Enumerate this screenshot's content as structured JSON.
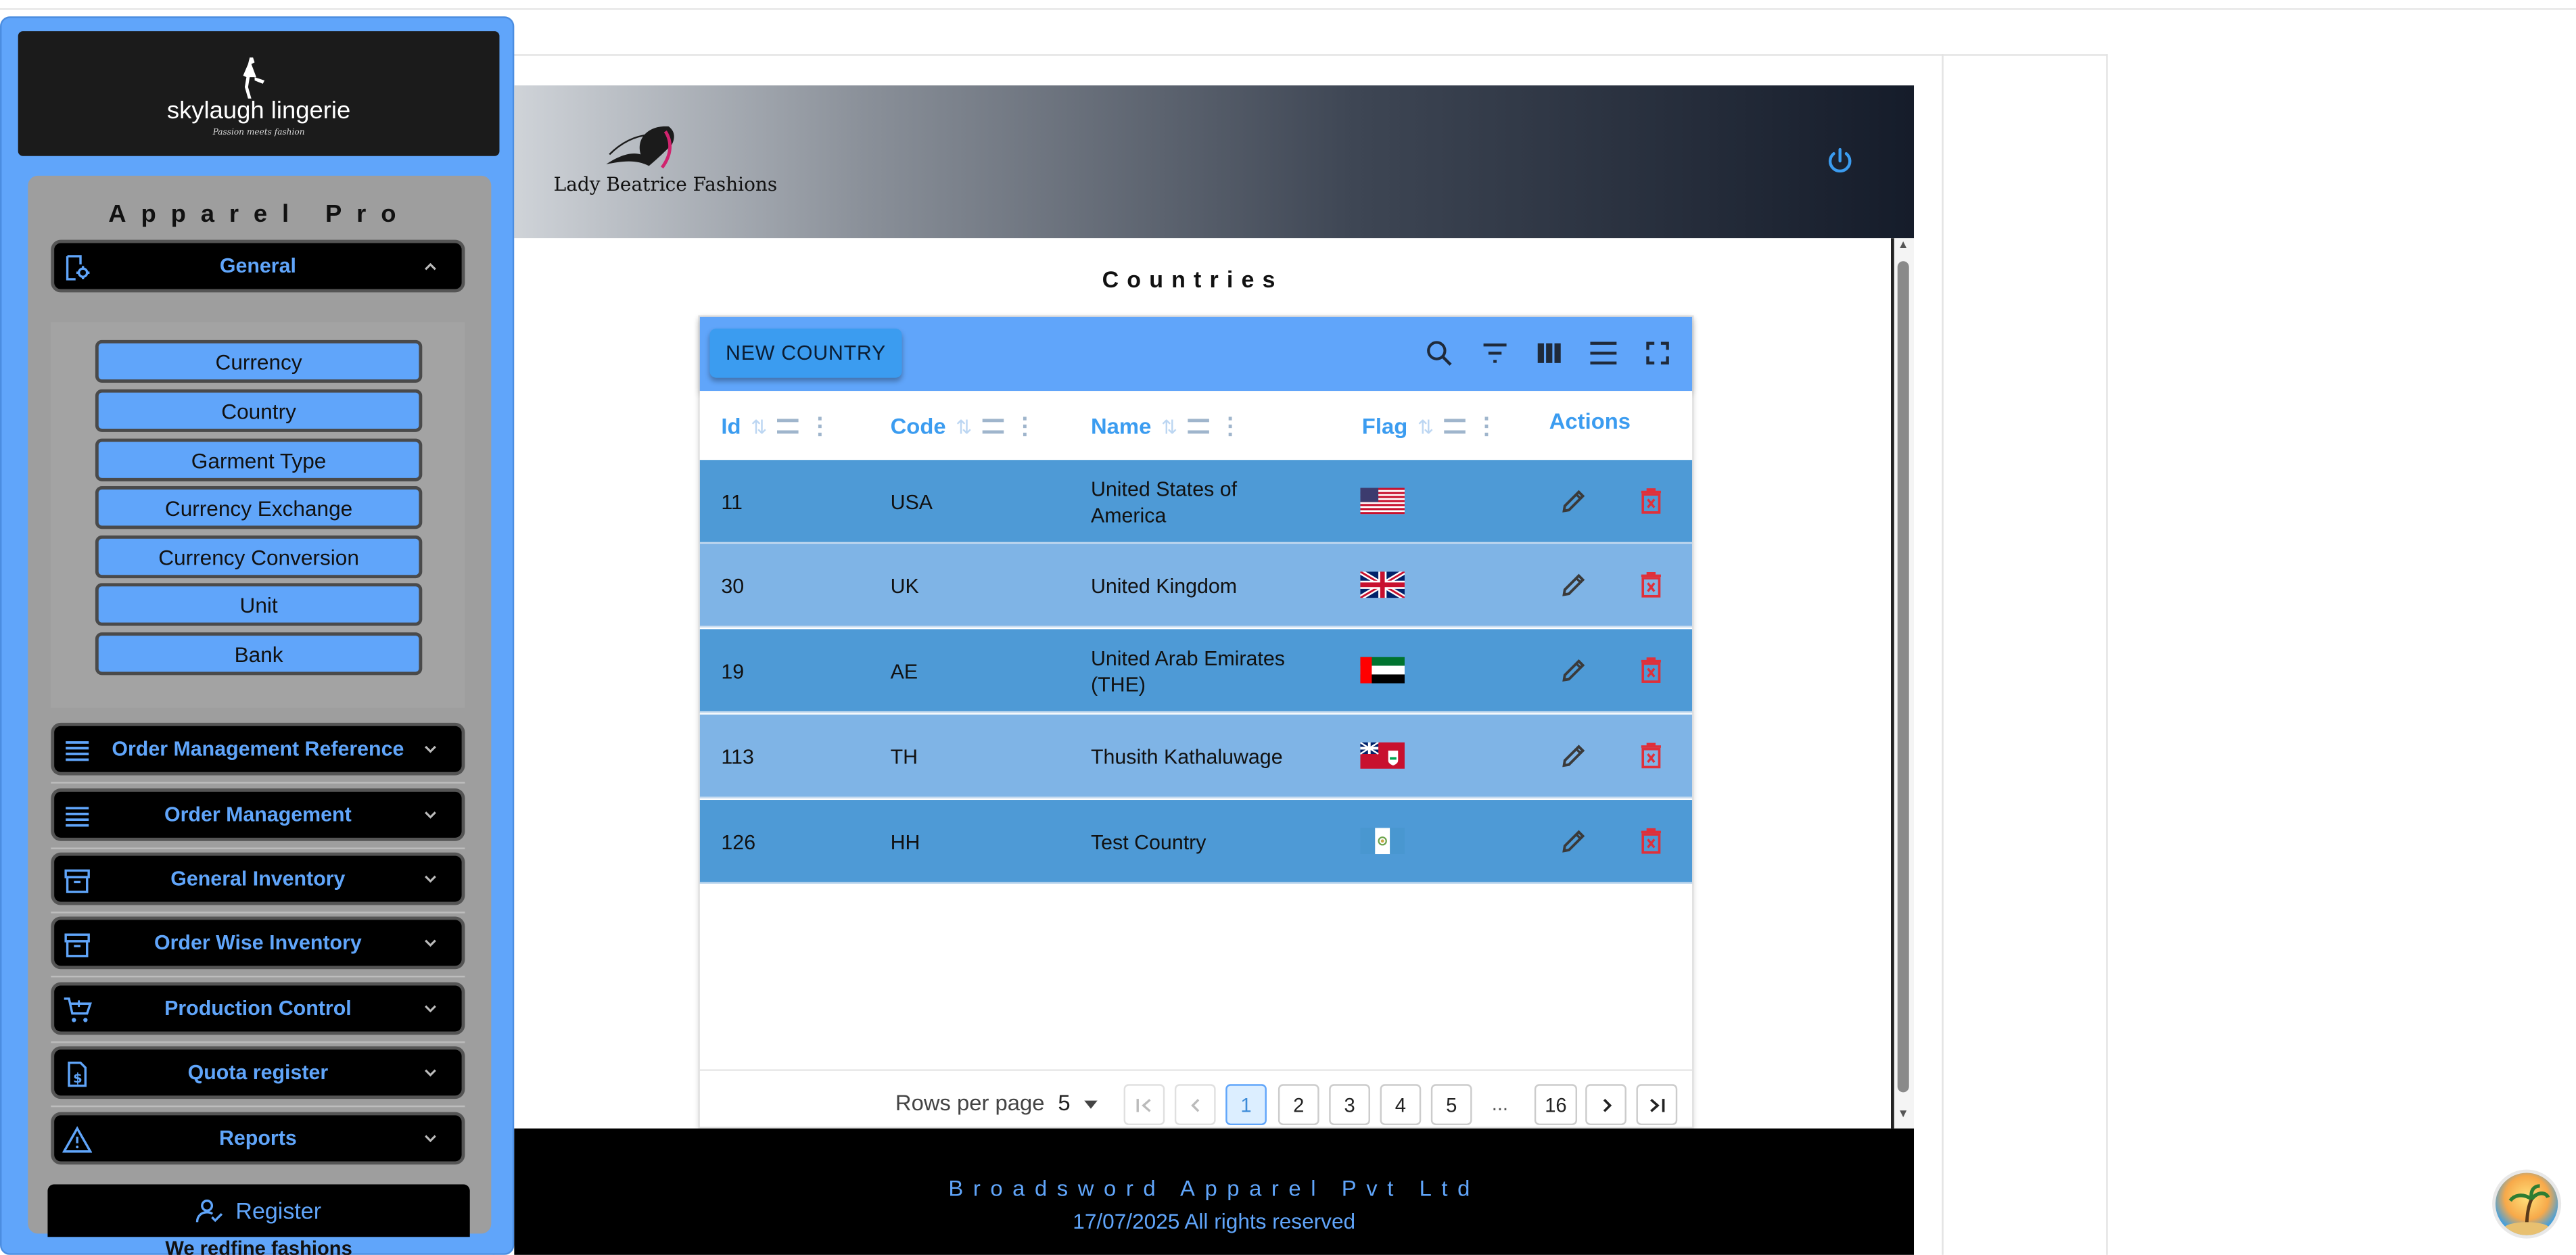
{
  "sidebar": {
    "logo_text": "skylaugh lingerie",
    "logo_tagline": "Passion meets fashion",
    "app_title": "Apparel Pro",
    "general": {
      "label": "General",
      "icon": "settings-document-icon"
    },
    "sub_items": [
      "Currency",
      "Country",
      "Garment Type",
      "Currency Exchange",
      "Currency Conversion",
      "Unit",
      "Bank"
    ],
    "sections": [
      {
        "label": "Order Management Reference",
        "icon": "list-icon"
      },
      {
        "label": "Order Management",
        "icon": "list-icon"
      },
      {
        "label": "General Inventory",
        "icon": "archive-icon"
      },
      {
        "label": "Order Wise Inventory",
        "icon": "archive-icon"
      },
      {
        "label": "Production Control",
        "icon": "cart-icon"
      },
      {
        "label": "Quota register",
        "icon": "dollar-doc-icon"
      },
      {
        "label": "Reports",
        "icon": "warning-icon"
      }
    ],
    "register_label": "Register",
    "tagline": "We redfine fashions"
  },
  "header": {
    "brand": "Lady Beatrice Fashions",
    "power_icon": "power-icon"
  },
  "page": {
    "title": "Countries"
  },
  "table": {
    "new_button": "NEW COUNTRY",
    "tools": [
      "search-icon",
      "filter-icon",
      "columns-icon",
      "density-icon",
      "fullscreen-icon"
    ],
    "columns": [
      "Id",
      "Code",
      "Name",
      "Flag",
      "Actions"
    ],
    "rows": [
      {
        "id": "11",
        "code": "USA",
        "name": "United States of America",
        "flag": "us"
      },
      {
        "id": "30",
        "code": "UK",
        "name": "United Kingdom",
        "flag": "gb"
      },
      {
        "id": "19",
        "code": "AE",
        "name": "United Arab Emirates (THE)",
        "flag": "ae"
      },
      {
        "id": "113",
        "code": "TH",
        "name": "Thusith Kathaluwage",
        "flag": "bm"
      },
      {
        "id": "126",
        "code": "HH",
        "name": "Test Country",
        "flag": "gt"
      }
    ],
    "pagination": {
      "rows_per_page_label": "Rows per page",
      "rows_per_page": "5",
      "pages": [
        "1",
        "2",
        "3",
        "4",
        "5"
      ],
      "ellipsis": "...",
      "last_page": "16",
      "current": "1"
    }
  },
  "footer": {
    "company": "Broadsword Apparel Pvt Ltd",
    "copyright": "17/07/2025 All rights reserved"
  },
  "colors": {
    "accent": "#60a5fa",
    "row_dark": "#4e9ad6",
    "row_light": "#7fb4e6",
    "delete": "#e0303a"
  }
}
